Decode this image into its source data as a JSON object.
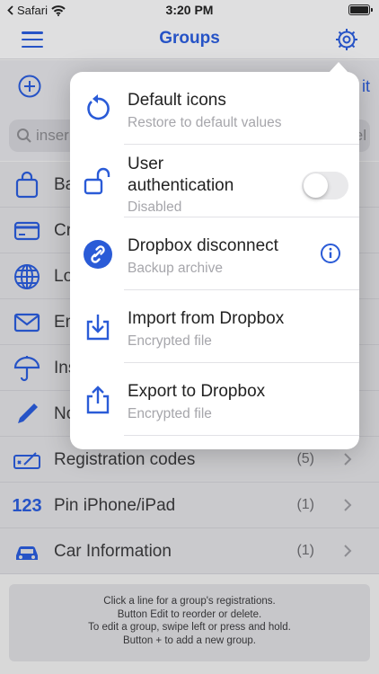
{
  "status_bar": {
    "carrier": "Safari",
    "time": "3:20 PM",
    "battery_level": 1.0
  },
  "nav": {
    "title": "Groups",
    "menu_icon": "hamburger-icon",
    "settings_icon": "gear-icon"
  },
  "toolbar": {
    "add_icon": "plus-circle-icon",
    "edit_label": "it"
  },
  "search": {
    "placeholder": "inser",
    "right_text": "el"
  },
  "groups": [
    {
      "label": "Ba",
      "count": "",
      "icon": "bag-icon"
    },
    {
      "label": "Cr",
      "count": "",
      "icon": "credit-card-icon"
    },
    {
      "label": "Lo",
      "count": "",
      "icon": "globe-icon"
    },
    {
      "label": "Em",
      "count": "",
      "icon": "envelope-icon"
    },
    {
      "label": "Ins",
      "count": "",
      "icon": "umbrella-icon"
    },
    {
      "label": "No",
      "count": "",
      "icon": "pencil-icon"
    },
    {
      "label": "Registration codes",
      "count": "(5)",
      "icon": "signature-icon"
    },
    {
      "label": "Pin iPhone/iPad",
      "count": "(1)",
      "icon": "number-icon",
      "glyph": "123"
    },
    {
      "label": "Car Information",
      "count": "(1)",
      "icon": "car-icon"
    }
  ],
  "footer": {
    "lines": [
      "Click a line for a group's registrations.",
      "Button Edit to reorder or delete.",
      "To edit a group, swipe left or press and hold.",
      "Button + to add a new group."
    ]
  },
  "menu": {
    "items": [
      {
        "title": "Default icons",
        "subtitle": "Restore to default values",
        "icon": "restore-icon"
      },
      {
        "title_line1": "User",
        "title_line2": "authentication",
        "subtitle": "Disabled",
        "icon": "unlock-icon",
        "toggle_on": false
      },
      {
        "title": "Dropbox disconnect",
        "subtitle": "Backup archive",
        "icon": "link-icon",
        "accessory": "info-icon"
      },
      {
        "title": "Import from Dropbox",
        "subtitle": "Encrypted file",
        "icon": "import-icon"
      },
      {
        "title": "Export to Dropbox",
        "subtitle": "Encrypted file",
        "icon": "export-icon"
      }
    ]
  },
  "colors": {
    "accent": "#2a5bd7",
    "subtitle": "#a6a6ab"
  }
}
